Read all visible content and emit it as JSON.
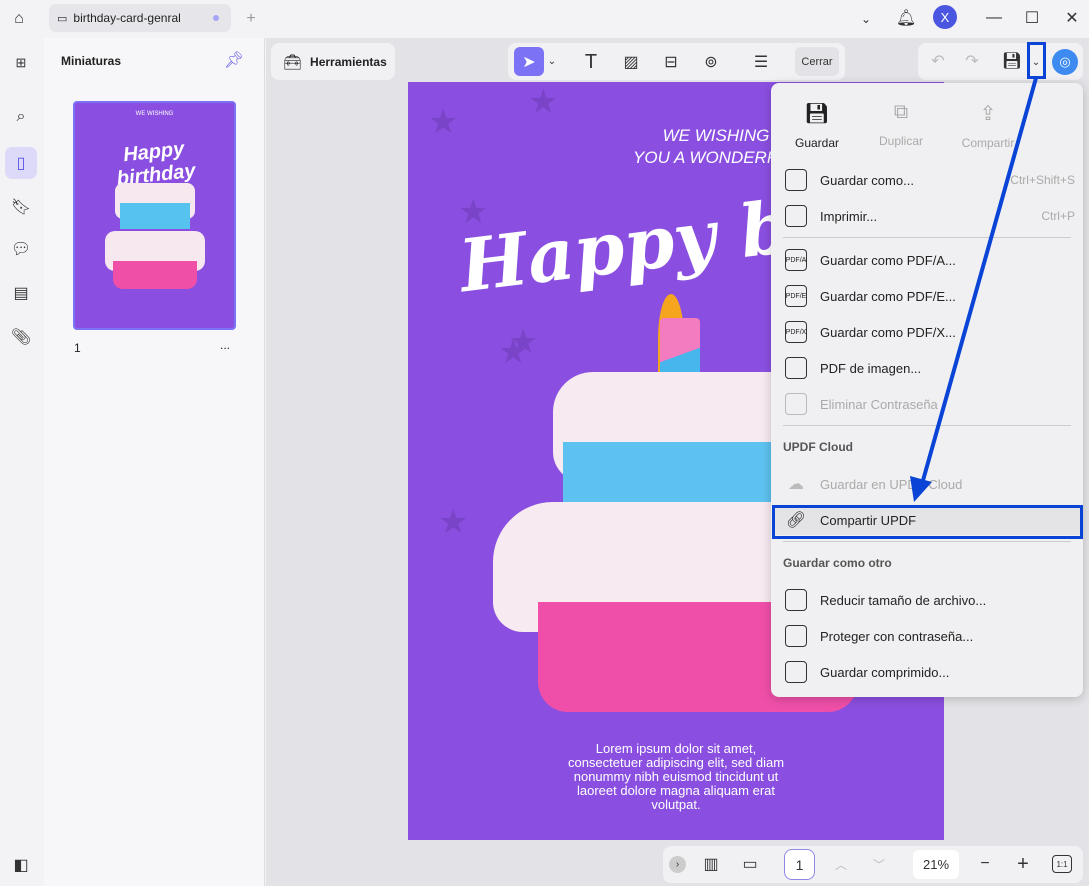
{
  "tab": {
    "title": "birthday-card-genral"
  },
  "account": {
    "initial": "X"
  },
  "sidebar": {
    "panel_title": "Miniaturas",
    "page_number": "1",
    "more": "..."
  },
  "toolbar": {
    "tools_label": "Herramientas",
    "close_label": "Cerrar"
  },
  "card": {
    "line1": "WE WISHING",
    "line2": "YOU A WONDERFUL",
    "headline": "Happy birthday",
    "body": [
      "Lorem ipsum dolor sit amet,",
      "consectetuer adipiscing elit, sed diam",
      "nonummy nibh euismod tincidunt ut",
      "laoreet dolore magna aliquam erat",
      "volutpat."
    ]
  },
  "menu": {
    "top": [
      {
        "label": "Guardar",
        "enabled": true
      },
      {
        "label": "Duplicar",
        "enabled": false
      },
      {
        "label": "Compartir",
        "enabled": false
      }
    ],
    "items": [
      {
        "label": "Guardar como...",
        "shortcut": "Ctrl+Shift+S",
        "icon": "save-as-icon",
        "enabled": true
      },
      {
        "label": "Imprimir...",
        "shortcut": "Ctrl+P",
        "icon": "printer-icon",
        "enabled": true
      },
      {
        "label": "Guardar como PDF/A...",
        "icon": "pdf-a-icon",
        "badge": "PDF/A",
        "enabled": true
      },
      {
        "label": "Guardar como PDF/E...",
        "icon": "pdf-e-icon",
        "badge": "PDF/E",
        "enabled": true
      },
      {
        "label": "Guardar como PDF/X...",
        "icon": "pdf-x-icon",
        "badge": "PDF/X",
        "enabled": true
      },
      {
        "label": "PDF de imagen...",
        "icon": "image-pdf-icon",
        "enabled": true
      },
      {
        "label": "Eliminar Contraseña",
        "icon": "remove-password-icon",
        "enabled": false
      }
    ],
    "cloud_header": "UPDF Cloud",
    "cloud_items": [
      {
        "label": "Guardar en UPDF Cloud",
        "enabled": false
      },
      {
        "label": "Compartir UPDF",
        "enabled": true,
        "highlighted": true
      }
    ],
    "other_header": "Guardar como otro",
    "other_items": [
      {
        "label": "Reducir tamaño de archivo..."
      },
      {
        "label": "Proteger con contraseña..."
      },
      {
        "label": "Guardar comprimido..."
      }
    ]
  },
  "bottombar": {
    "page": "1",
    "zoom": "21%",
    "fit": "1:1"
  },
  "colors": {
    "accent": "#7b72f5",
    "annotation": "#0a44d6",
    "card": "#8a4fe0"
  }
}
